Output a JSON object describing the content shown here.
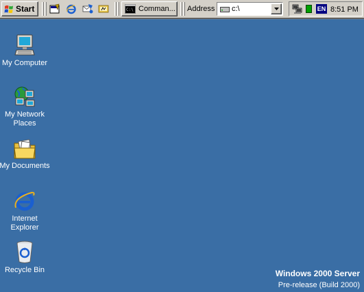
{
  "taskbar": {
    "start_label": "Start",
    "quick_launch": [
      "show-desktop",
      "internet-explorer",
      "outlook-express",
      "windows-media"
    ],
    "task_button_label": "Comman...",
    "address_label": "Address",
    "address_value": "c:\\",
    "language": "EN",
    "clock": "8:51 PM"
  },
  "desktop": {
    "background_color": "#3a6ea5",
    "icons": [
      {
        "label_lines": [
          "My Computer"
        ],
        "icon": "my-computer-icon"
      },
      {
        "label_lines": [
          "My Network",
          "Places"
        ],
        "icon": "network-places-icon"
      },
      {
        "label_lines": [
          "My Documents"
        ],
        "icon": "my-documents-icon"
      },
      {
        "label_lines": [
          "Internet",
          "Explorer"
        ],
        "icon": "internet-explorer-icon"
      },
      {
        "label_lines": [
          "Recycle Bin"
        ],
        "icon": "recycle-bin-icon"
      }
    ]
  },
  "watermark": {
    "title": "Windows 2000 Server",
    "subtitle": "Pre-release (Build 2000)"
  }
}
